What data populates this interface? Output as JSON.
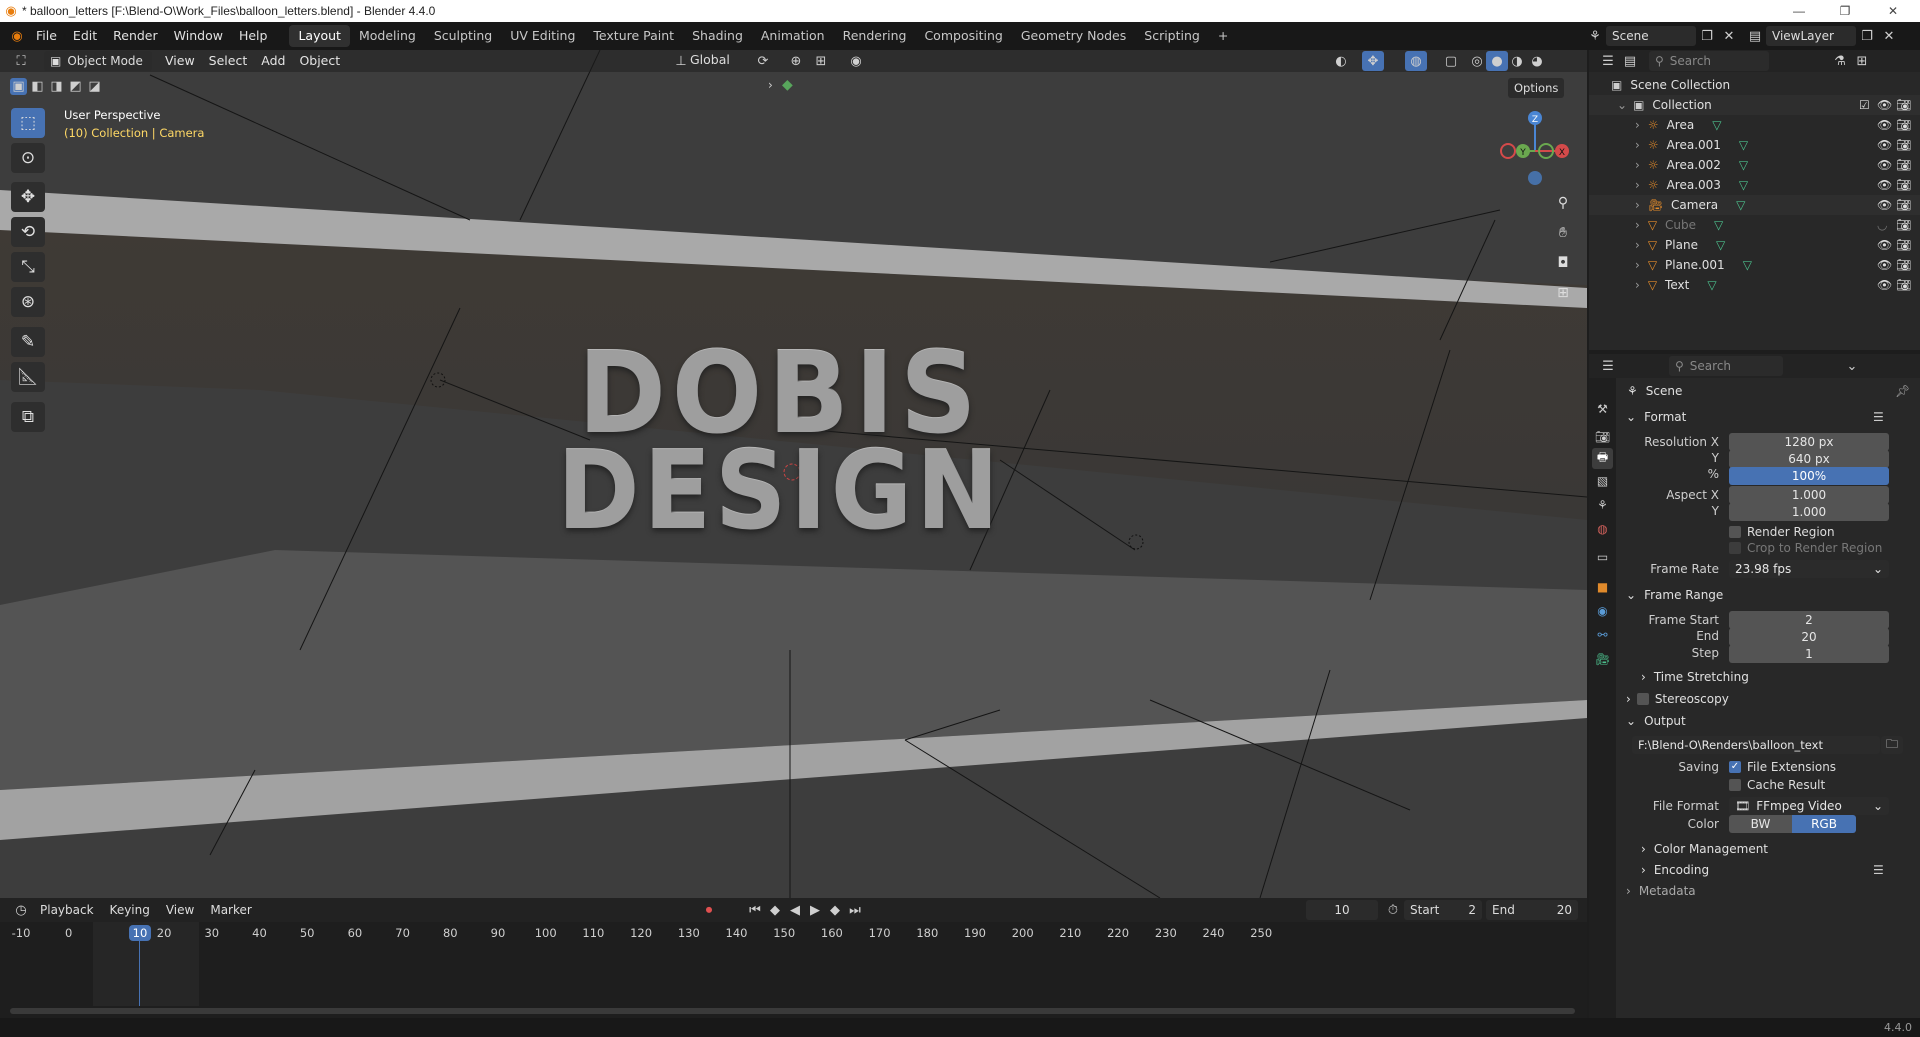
{
  "window": {
    "title": "* balloon_letters [F:\\Blend-O\\Work_Files\\balloon_letters.blend] - Blender 4.4.0",
    "minimize": "—",
    "restore": "❐",
    "close": "✕"
  },
  "menubar": {
    "items": [
      "File",
      "Edit",
      "Render",
      "Window",
      "Help"
    ]
  },
  "workspaces": [
    "Layout",
    "Modeling",
    "Sculpting",
    "UV Editing",
    "Texture Paint",
    "Shading",
    "Animation",
    "Rendering",
    "Compositing",
    "Geometry Nodes",
    "Scripting"
  ],
  "workspace_add": "+",
  "scene": {
    "name": "Scene",
    "view_layer": "ViewLayer"
  },
  "viewport": {
    "mode": "Object Mode",
    "menus": [
      "View",
      "Select",
      "Add",
      "Object"
    ],
    "transform_orientation": "Global",
    "options": "Options",
    "info_line1": "User Perspective",
    "info_line2": "(10) Collection | Camera",
    "gizmo": {
      "z": "Z",
      "y": "Y",
      "x": "X"
    },
    "text_lines": [
      "DOBIS",
      "DESIGN"
    ]
  },
  "outliner": {
    "search_placeholder": "Search",
    "scene_collection": "Scene Collection",
    "collection": "Collection",
    "items": [
      {
        "name": "Area",
        "type": "light",
        "visible": true
      },
      {
        "name": "Area.001",
        "type": "light",
        "visible": true
      },
      {
        "name": "Area.002",
        "type": "light",
        "visible": true
      },
      {
        "name": "Area.003",
        "type": "light",
        "visible": true
      },
      {
        "name": "Camera",
        "type": "camera",
        "visible": true
      },
      {
        "name": "Cube",
        "type": "mesh",
        "visible": false
      },
      {
        "name": "Plane",
        "type": "mesh",
        "visible": true
      },
      {
        "name": "Plane.001",
        "type": "mesh",
        "visible": true
      },
      {
        "name": "Text",
        "type": "mesh",
        "visible": true
      }
    ]
  },
  "properties": {
    "search_placeholder": "Search",
    "context": "Scene",
    "format": {
      "header": "Format",
      "resolution_x_label": "Resolution X",
      "resolution_x": "1280 px",
      "resolution_y_label": "Y",
      "resolution_y": "640 px",
      "percent_label": "%",
      "percent": "100%",
      "aspect_x_label": "Aspect X",
      "aspect_x": "1.000",
      "aspect_y_label": "Y",
      "aspect_y": "1.000",
      "render_region": "Render Region",
      "crop_region": "Crop to Render Region",
      "frame_rate_label": "Frame Rate",
      "frame_rate": "23.98 fps"
    },
    "frame_range": {
      "header": "Frame Range",
      "start_label": "Frame Start",
      "start": "2",
      "end_label": "End",
      "end": "20",
      "step_label": "Step",
      "step": "1"
    },
    "time_stretching": "Time Stretching",
    "stereoscopy": "Stereoscopy",
    "output": {
      "header": "Output",
      "path": "F:\\Blend-O\\Renders\\balloon_text",
      "saving_label": "Saving",
      "file_extensions": "File Extensions",
      "cache_result": "Cache Result",
      "file_format_label": "File Format",
      "file_format": "FFmpeg Video",
      "color_label": "Color",
      "color_bw": "BW",
      "color_rgb": "RGB",
      "color_management": "Color Management",
      "encoding": "Encoding",
      "metadata": "Metadata"
    }
  },
  "timeline": {
    "menus": [
      "Playback",
      "Keying",
      "View",
      "Marker"
    ],
    "current_frame": "10",
    "start_label": "Start",
    "start": "2",
    "end_label": "End",
    "end": "20",
    "ruler": [
      "-10",
      "0",
      "10",
      "20",
      "30",
      "40",
      "50",
      "60",
      "70",
      "80",
      "90",
      "100",
      "110",
      "120",
      "130",
      "140",
      "150",
      "160",
      "170",
      "180",
      "190",
      "200",
      "210",
      "220",
      "230",
      "240",
      "250"
    ],
    "playhead_value": "10"
  },
  "status": {
    "version": "4.4.0"
  }
}
